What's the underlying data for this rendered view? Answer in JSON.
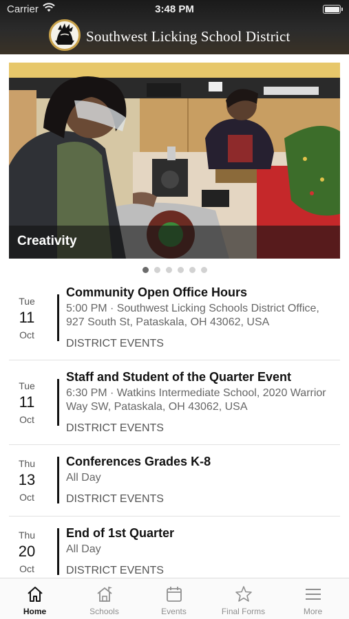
{
  "status": {
    "carrier": "Carrier",
    "time": "3:48 PM"
  },
  "header": {
    "title": "Southwest Licking School District"
  },
  "hero": {
    "caption": "Creativity",
    "page_count": 6,
    "active_page": 1
  },
  "events": [
    {
      "dow": "Tue",
      "day": "11",
      "month": "Oct",
      "title": "Community Open Office Hours",
      "detail": "5:00 PM · Southwest Licking Schools District Office, 927 South St, Pataskala, OH 43062, USA",
      "category": "DISTRICT EVENTS"
    },
    {
      "dow": "Tue",
      "day": "11",
      "month": "Oct",
      "title": "Staff and Student of the Quarter Event",
      "detail": "6:30 PM · Watkins Intermediate School, 2020 Warrior Way SW, Pataskala, OH 43062, USA",
      "category": "DISTRICT EVENTS"
    },
    {
      "dow": "Thu",
      "day": "13",
      "month": "Oct",
      "title": "Conferences Grades K-8",
      "detail": "All Day",
      "category": "DISTRICT EVENTS"
    },
    {
      "dow": "Thu",
      "day": "20",
      "month": "Oct",
      "title": "End of 1st Quarter",
      "detail": "All Day",
      "category": "DISTRICT EVENTS"
    }
  ],
  "tabs": [
    {
      "label": "Home",
      "icon": "home-icon",
      "active": true
    },
    {
      "label": "Schools",
      "icon": "school-icon",
      "active": false
    },
    {
      "label": "Events",
      "icon": "calendar-icon",
      "active": false
    },
    {
      "label": "Final Forms",
      "icon": "star-icon",
      "active": false
    },
    {
      "label": "More",
      "icon": "menu-icon",
      "active": false
    }
  ]
}
